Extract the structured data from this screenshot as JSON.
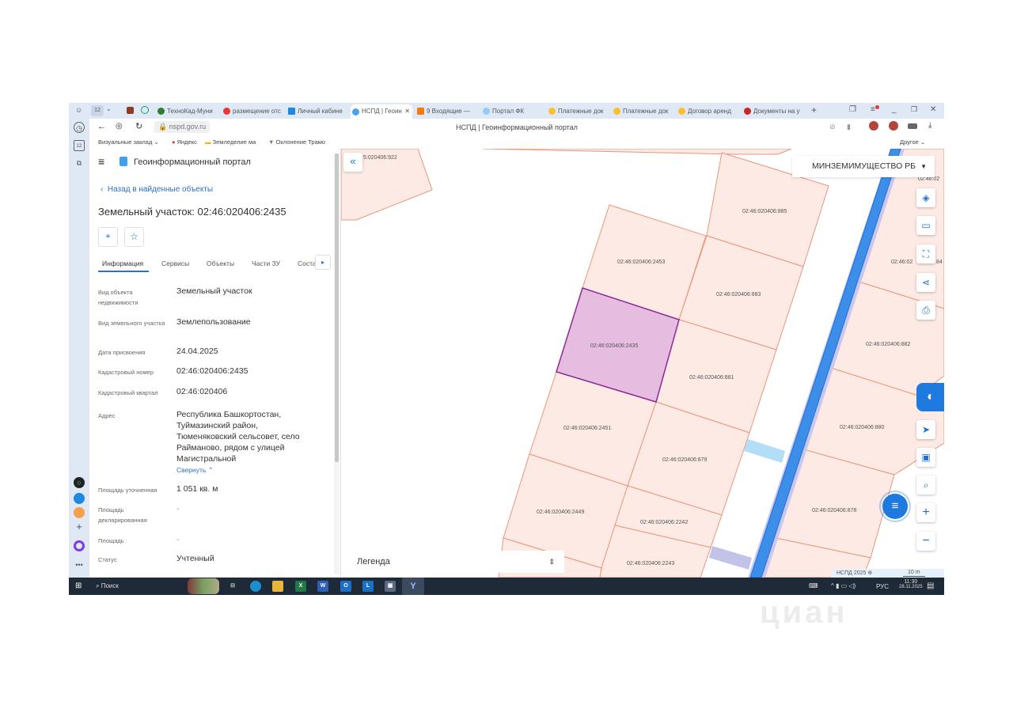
{
  "browser": {
    "tabs": [
      {
        "label": "ТехноКад-Муни",
        "color": "#2e7d32"
      },
      {
        "label": "размещение отс",
        "color": "#e53935"
      },
      {
        "label": "Личный кабине",
        "color": "#1e88e5"
      },
      {
        "label": "НСПД | Геоин",
        "color": "#1e88e5",
        "active": true
      },
      {
        "label": "9 Входящие —",
        "color": "#f57c00"
      },
      {
        "label": "Портал ФК",
        "color": "#90caf9"
      },
      {
        "label": "Платежные док",
        "color": "#fbc02d"
      },
      {
        "label": "Платежные док",
        "color": "#fbc02d"
      },
      {
        "label": "Договор аренд",
        "color": "#fbc02d"
      },
      {
        "label": "Документы на у",
        "color": "#c62828"
      }
    ],
    "tab_counter": "12",
    "side_counter": "12",
    "url": "nspd.gov.ru",
    "page_title": "НСПД | Геоинформационный портал",
    "bookmarks": [
      "Визуальные заклад",
      "Яндекс",
      "Земледелие ма",
      "Оклонение Трамо"
    ],
    "bookmarks_other": "Другое"
  },
  "portal": {
    "title": "Геоинформационный портал",
    "back_link": "Назад в найденные объекты",
    "object_title": "Земельный участок: 02:46:020406:2435",
    "tabs": [
      "Информация",
      "Сервисы",
      "Объекты",
      "Части ЗУ",
      "Состав"
    ],
    "active_tab": "Информация",
    "fields": [
      {
        "label": "Вид объекта недвижимости",
        "value": "Земельный участок"
      },
      {
        "label": "Вид земельного участка",
        "value": "Землепользование"
      },
      {
        "label": "Дата присвоения",
        "value": "24.04.2025"
      },
      {
        "label": "Кадастровый номер",
        "value": "02:46:020406:2435"
      },
      {
        "label": "Кадастровый квартал",
        "value": "02:46:020406"
      },
      {
        "label": "Адрес",
        "value": "Республика Башкортостан, Туймазинский район, Тюменяковский сельсовет, село Райманово, рядом с улицей Магистральной"
      },
      {
        "label": "Площадь уточненная",
        "value": "1 051 кв. м"
      },
      {
        "label": "Площадь декларированная",
        "value": "-"
      },
      {
        "label": "Площадь",
        "value": "-"
      },
      {
        "label": "Статус",
        "value": "Учтенный"
      }
    ],
    "collapse_link": "Свернуть"
  },
  "map": {
    "layer_select": "МИНЗЕМИМУЩЕСТВО РБ",
    "legend": "Легенда",
    "attribution": "НСПД 2025",
    "scale": "10 m",
    "parcels": {
      "p922": "5:020406:922",
      "p2453": "02:46:020406:2453",
      "p885": "02:46:020406:885",
      "p883": "02:46:020406:883",
      "p2435": "02:46:020406:2435",
      "p881": "02:46:020406:881",
      "p2451": "02:46:020406:2451",
      "p879": "02:46:020406:879",
      "p2449": "02:46:020406:2449",
      "p2242": "02:46:020406:2242",
      "p2243": "02:46:020406:2243",
      "p882": "02:46:020406:882",
      "p880": "02:46:020406:880",
      "p878": "02:46:020406:878",
      "p884": "02:46:02",
      "p884b": "84",
      "ptop": "02:46:02"
    },
    "colors": {
      "parcel_fill": "#fdeae4",
      "parcel_stroke": "#e8967a",
      "selected_fill": "#e6bde0",
      "selected_stroke": "#8e2a95",
      "road": "#3d8ee8"
    }
  },
  "taskbar": {
    "search": "Поиск",
    "lang": "РУС",
    "time": "11:30",
    "date": "28.11.2025"
  },
  "watermark": "циан"
}
